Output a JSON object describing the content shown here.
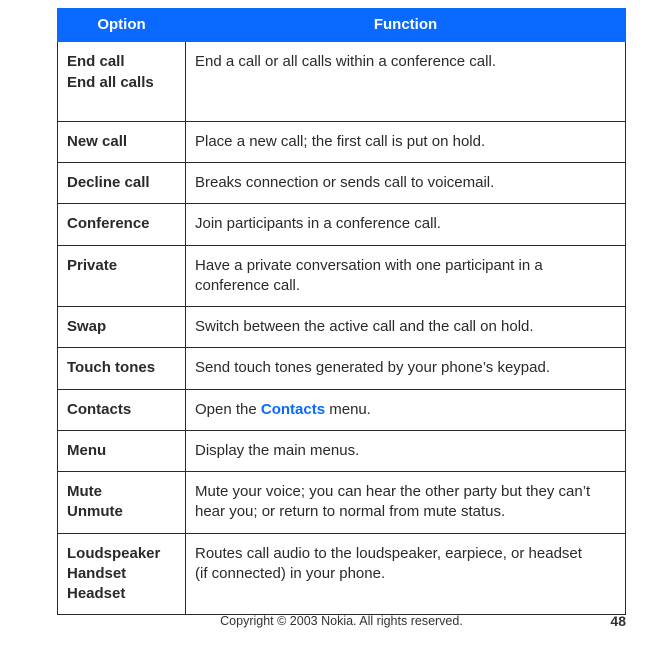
{
  "header": {
    "option": "Option",
    "function": "Function"
  },
  "rows": [
    {
      "option_lines": [
        "End call",
        "End all calls"
      ],
      "function_parts": [
        {
          "text": "End a call or all calls within a conference call."
        }
      ],
      "pad_bottom": true
    },
    {
      "option_lines": [
        "New call"
      ],
      "function_parts": [
        {
          "text": "Place a new call; the first call is put on hold."
        }
      ]
    },
    {
      "option_lines": [
        "Decline call"
      ],
      "function_parts": [
        {
          "text": "Breaks connection or sends call to voicemail."
        }
      ]
    },
    {
      "option_lines": [
        "Conference"
      ],
      "function_parts": [
        {
          "text": "Join participants in a conference call."
        }
      ]
    },
    {
      "option_lines": [
        "Private"
      ],
      "function_parts": [
        {
          "text": "Have a private conversation with one participant in a conference call."
        }
      ]
    },
    {
      "option_lines": [
        "Swap"
      ],
      "function_parts": [
        {
          "text": "Switch between the active call and the call on hold."
        }
      ]
    },
    {
      "option_lines": [
        "Touch tones"
      ],
      "function_parts": [
        {
          "text": "Send touch tones generated by your phone’s keypad."
        }
      ]
    },
    {
      "option_lines": [
        "Contacts"
      ],
      "function_parts": [
        {
          "text": "Open the "
        },
        {
          "text": "Contacts",
          "link": true
        },
        {
          "text": " menu."
        }
      ]
    },
    {
      "option_lines": [
        "Menu"
      ],
      "function_parts": [
        {
          "text": "Display the main menus."
        }
      ]
    },
    {
      "option_lines": [
        "Mute",
        "Unmute"
      ],
      "function_parts": [
        {
          "text": "Mute your voice; you can hear the other party but they can’t hear you; or return to normal from mute status."
        }
      ]
    },
    {
      "option_lines": [
        "Loudspeaker",
        "Handset",
        "Headset"
      ],
      "function_parts": [
        {
          "text": "Routes call audio to the loudspeaker, earpiece, or headset"
        },
        {
          "br": true
        },
        {
          "text": "(if connected) in your phone."
        }
      ]
    }
  ],
  "footer": {
    "copyright": "Copyright © 2003 Nokia. All rights reserved.",
    "page": "48"
  }
}
